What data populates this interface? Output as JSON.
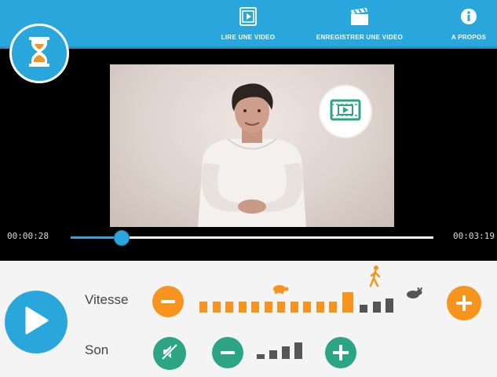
{
  "header": {
    "nav": [
      {
        "label": "LIRE UNE VIDEO",
        "icon": "video-file-icon"
      },
      {
        "label": "ENREGISTRER UNE VIDEO",
        "icon": "clapperboard-icon"
      },
      {
        "label": "A PROPOS",
        "icon": "info-icon"
      }
    ],
    "logo_icon": "hourglass-icon"
  },
  "player": {
    "current_time": "00:00:28",
    "total_time": "00:03:19",
    "progress": 0.14,
    "badge_icon": "video-file-icon"
  },
  "controls": {
    "play_icon": "play-icon",
    "speed": {
      "label": "Vitesse",
      "levels": 15,
      "selected_level": 12,
      "markers": [
        "turtle-icon",
        "walking-person-icon",
        "rabbit-icon"
      ]
    },
    "sound": {
      "label": "Son",
      "mute_icon": "mute-icon",
      "levels": 4,
      "filled_levels": 4
    }
  },
  "colors": {
    "primary_blue": "#29a7dd",
    "orange": "#f7941d",
    "green": "#2ba584",
    "dark_gray": "#555555"
  }
}
